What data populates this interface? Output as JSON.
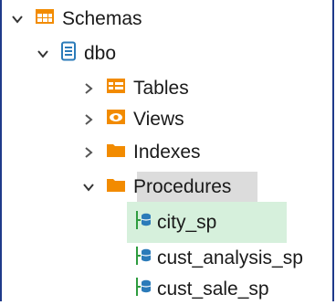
{
  "tree": {
    "schemas": {
      "label": "Schemas",
      "icon": "schema-table-icon"
    },
    "dbo": {
      "label": "dbo",
      "icon": "schema-doc-icon"
    },
    "tables": {
      "label": "Tables",
      "icon": "tables-icon"
    },
    "views": {
      "label": "Views",
      "icon": "views-eye-icon"
    },
    "indexes": {
      "label": "Indexes",
      "icon": "folder-icon"
    },
    "procedures": {
      "label": "Procedures",
      "icon": "folder-icon"
    },
    "procedure_items": [
      {
        "label": "city_sp",
        "icon": "stored-procedure-icon"
      },
      {
        "label": "cust_analysis_sp",
        "icon": "stored-procedure-icon"
      },
      {
        "label": "cust_sale_sp",
        "icon": "stored-procedure-icon"
      }
    ]
  },
  "colors": {
    "accent_orange": "#f28b00",
    "selection_gray": "#dcdcdc",
    "highlight_green": "#d6f0dc",
    "proc_icon_blue": "#2b7bb9",
    "proc_icon_green": "#2e9c3f"
  }
}
